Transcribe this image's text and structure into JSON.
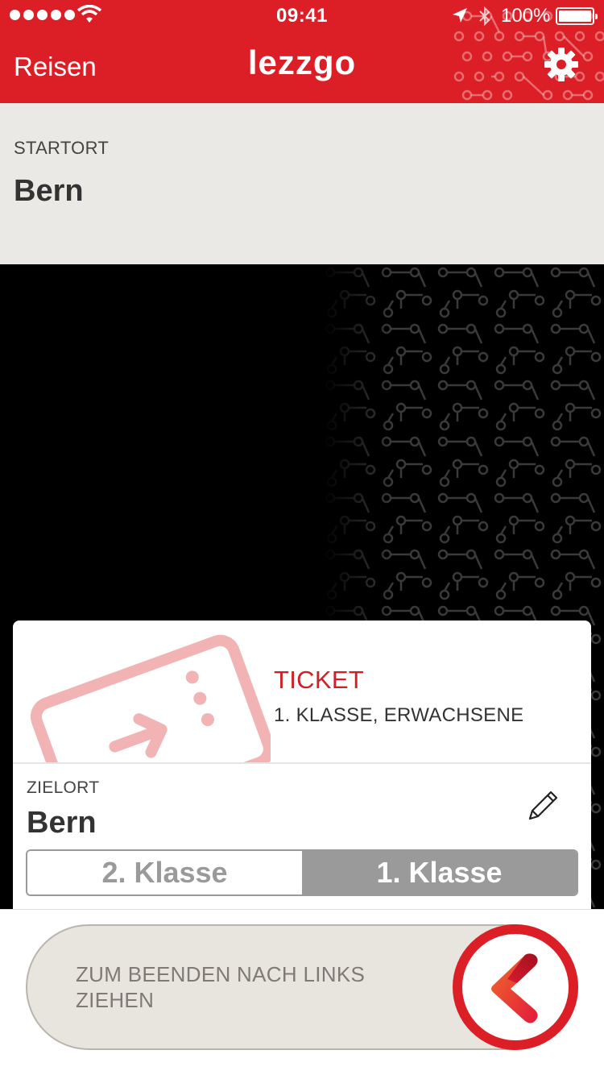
{
  "status_bar": {
    "time": "09:41",
    "battery": "100%"
  },
  "nav": {
    "back_label": "Reisen",
    "app_title": "lezzgo",
    "settings_icon": "gear-icon"
  },
  "start": {
    "label": "STARTORT",
    "value": "Bern"
  },
  "ticket": {
    "type": "TICKET",
    "detail": "1. KLASSE, ERWACHSENE",
    "icon": "ticket-icon"
  },
  "destination": {
    "label": "ZIELORT",
    "value": "Bern",
    "edit_icon": "pencil-icon"
  },
  "class_selector": {
    "options": [
      "2. Klasse",
      "1. Klasse"
    ],
    "selected": "1. Klasse"
  },
  "slider": {
    "label": "ZUM BEENDEN NACH LINKS ZIEHEN",
    "knob_icon": "lezzgo-logo-icon"
  },
  "colors": {
    "brand_red": "#dc1f26",
    "panel_beige": "#ebe9e5",
    "segment_gray": "#9a9a9a"
  }
}
